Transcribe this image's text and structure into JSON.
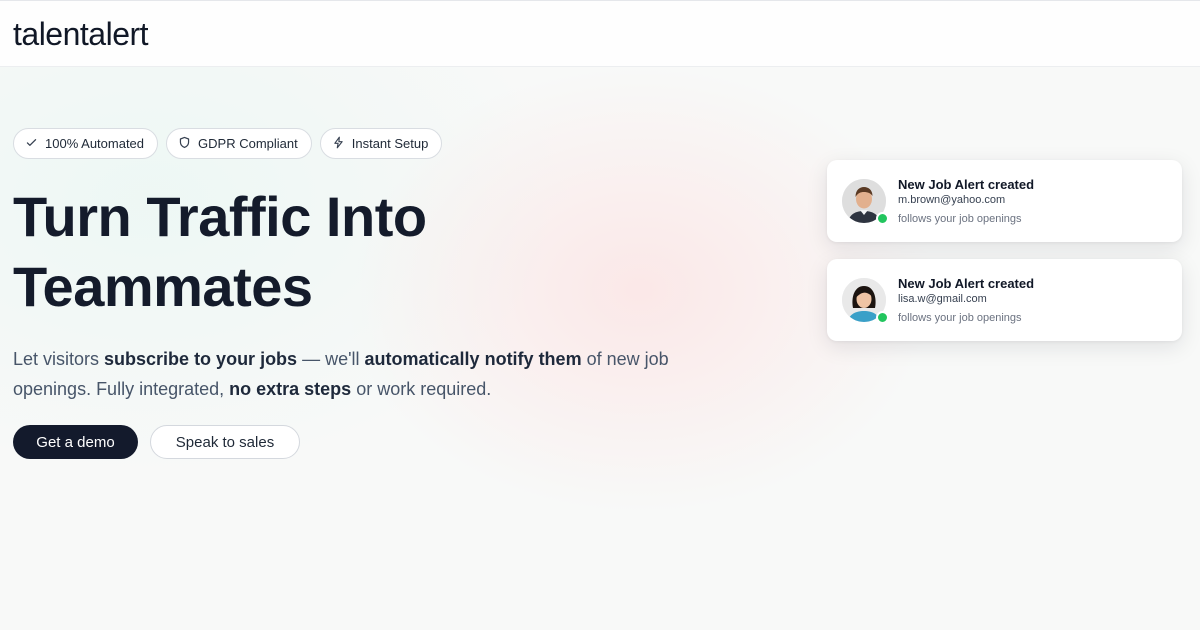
{
  "header": {
    "logo": "talentalert"
  },
  "badges": [
    {
      "icon": "check-icon",
      "label": "100% Automated"
    },
    {
      "icon": "shield-icon",
      "label": "GDPR Compliant"
    },
    {
      "icon": "lightning-icon",
      "label": "Instant Setup"
    }
  ],
  "hero": {
    "headline_line1": "Turn Traffic Into",
    "headline_line2": "Teammates",
    "sub": {
      "t1": "Let visitors ",
      "b1": "subscribe to your jobs",
      "t2": " — we'll ",
      "b2": "automatically notify them",
      "t3": " of new job openings. Fully integrated, ",
      "b3": "no extra steps",
      "t4": " or work required."
    }
  },
  "cta": {
    "primary": "Get a demo",
    "secondary": "Speak to sales"
  },
  "notifications": [
    {
      "title": "New Job Alert created",
      "email": "m.brown@yahoo.com",
      "note": "follows your job openings",
      "avatar": "man-avatar",
      "status_color": "#22c55e"
    },
    {
      "title": "New Job Alert created",
      "email": "lisa.w@gmail.com",
      "note": "follows your job openings",
      "avatar": "woman-avatar",
      "status_color": "#22c55e"
    }
  ],
  "colors": {
    "primary_button": "#131a2c",
    "online_dot": "#22c55e",
    "headline": "#141b2b"
  }
}
